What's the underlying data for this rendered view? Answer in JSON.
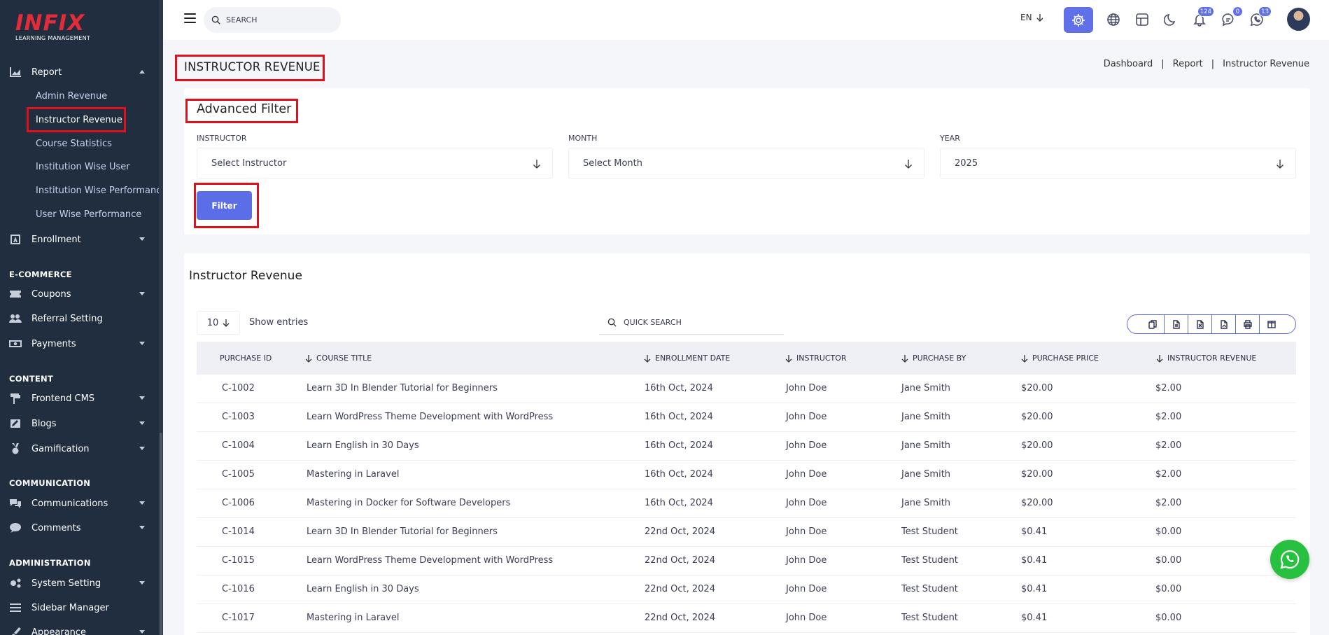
{
  "logo": {
    "brand": "INFIX",
    "sub": "LEARNING MANAGEMENT"
  },
  "sidebar": {
    "report": {
      "label": "Report"
    },
    "report_items": [
      "Admin Revenue",
      "Instructor Revenue",
      "Course Statistics",
      "Institution Wise User",
      "Institution Wise Performance",
      "User Wise Performance"
    ],
    "enrollment": {
      "label": "Enrollment"
    },
    "sections": {
      "ecommerce": "E-COMMERCE",
      "content": "CONTENT",
      "communication": "COMMUNICATION",
      "administration": "ADMINISTRATION"
    },
    "ecommerce_items": [
      "Coupons",
      "Referral Setting",
      "Payments"
    ],
    "content_items": [
      "Frontend CMS",
      "Blogs",
      "Gamification"
    ],
    "communication_items": [
      "Communications",
      "Comments"
    ],
    "administration_items": [
      "System Setting",
      "Sidebar Manager",
      "Appearance"
    ]
  },
  "topbar": {
    "search_placeholder": "SEARCH",
    "language": "EN",
    "notifications_count": "124",
    "messages_count": "0",
    "whatsapp_count": "13"
  },
  "page": {
    "title": "INSTRUCTOR REVENUE",
    "breadcrumb": [
      "Dashboard",
      "Report",
      "Instructor Revenue"
    ],
    "breadcrumb_sep": "|"
  },
  "filter": {
    "title": "Advanced Filter",
    "instructor_label": "INSTRUCTOR",
    "instructor_value": "Select Instructor",
    "month_label": "MONTH",
    "month_value": "Select Month",
    "year_label": "YEAR",
    "year_value": "2025",
    "button": "Filter"
  },
  "table": {
    "title": "Instructor Revenue",
    "entries_value": "10",
    "show_entries": "Show entries",
    "quick_search_placeholder": "QUICK SEARCH",
    "columns": [
      "PURCHASE ID",
      "COURSE TITLE",
      "ENROLLMENT DATE",
      "INSTRUCTOR",
      "PURCHASE BY",
      "PURCHASE PRICE",
      "INSTRUCTOR REVENUE"
    ],
    "rows": [
      [
        "C-1002",
        "Learn 3D In Blender Tutorial for Beginners",
        "16th Oct, 2024",
        "John Doe",
        "Jane Smith",
        "$20.00",
        "$2.00"
      ],
      [
        "C-1003",
        "Learn WordPress Theme Development with WordPress",
        "16th Oct, 2024",
        "John Doe",
        "Jane Smith",
        "$20.00",
        "$2.00"
      ],
      [
        "C-1004",
        "Learn English in 30 Days",
        "16th Oct, 2024",
        "John Doe",
        "Jane Smith",
        "$20.00",
        "$2.00"
      ],
      [
        "C-1005",
        "Mastering in Laravel",
        "16th Oct, 2024",
        "John Doe",
        "Jane Smith",
        "$20.00",
        "$2.00"
      ],
      [
        "C-1006",
        "Mastering in Docker for Software Developers",
        "16th Oct, 2024",
        "John Doe",
        "Jane Smith",
        "$20.00",
        "$2.00"
      ],
      [
        "C-1014",
        "Learn 3D In Blender Tutorial for Beginners",
        "22nd Oct, 2024",
        "John Doe",
        "Test Student",
        "$0.41",
        "$0.00"
      ],
      [
        "C-1015",
        "Learn WordPress Theme Development with WordPress",
        "22nd Oct, 2024",
        "John Doe",
        "Test Student",
        "$0.41",
        "$0.00"
      ],
      [
        "C-1016",
        "Learn English in 30 Days",
        "22nd Oct, 2024",
        "John Doe",
        "Test Student",
        "$0.41",
        "$0.00"
      ],
      [
        "C-1017",
        "Mastering in Laravel",
        "22nd Oct, 2024",
        "John Doe",
        "Test Student",
        "$0.41",
        "$0.00"
      ]
    ]
  },
  "colors": {
    "accent": "#5b6ee8",
    "sidebar_bg": "#202e3f",
    "highlight_box": "#e0101c",
    "brand": "#e32b39",
    "whatsapp": "#28c13f"
  }
}
